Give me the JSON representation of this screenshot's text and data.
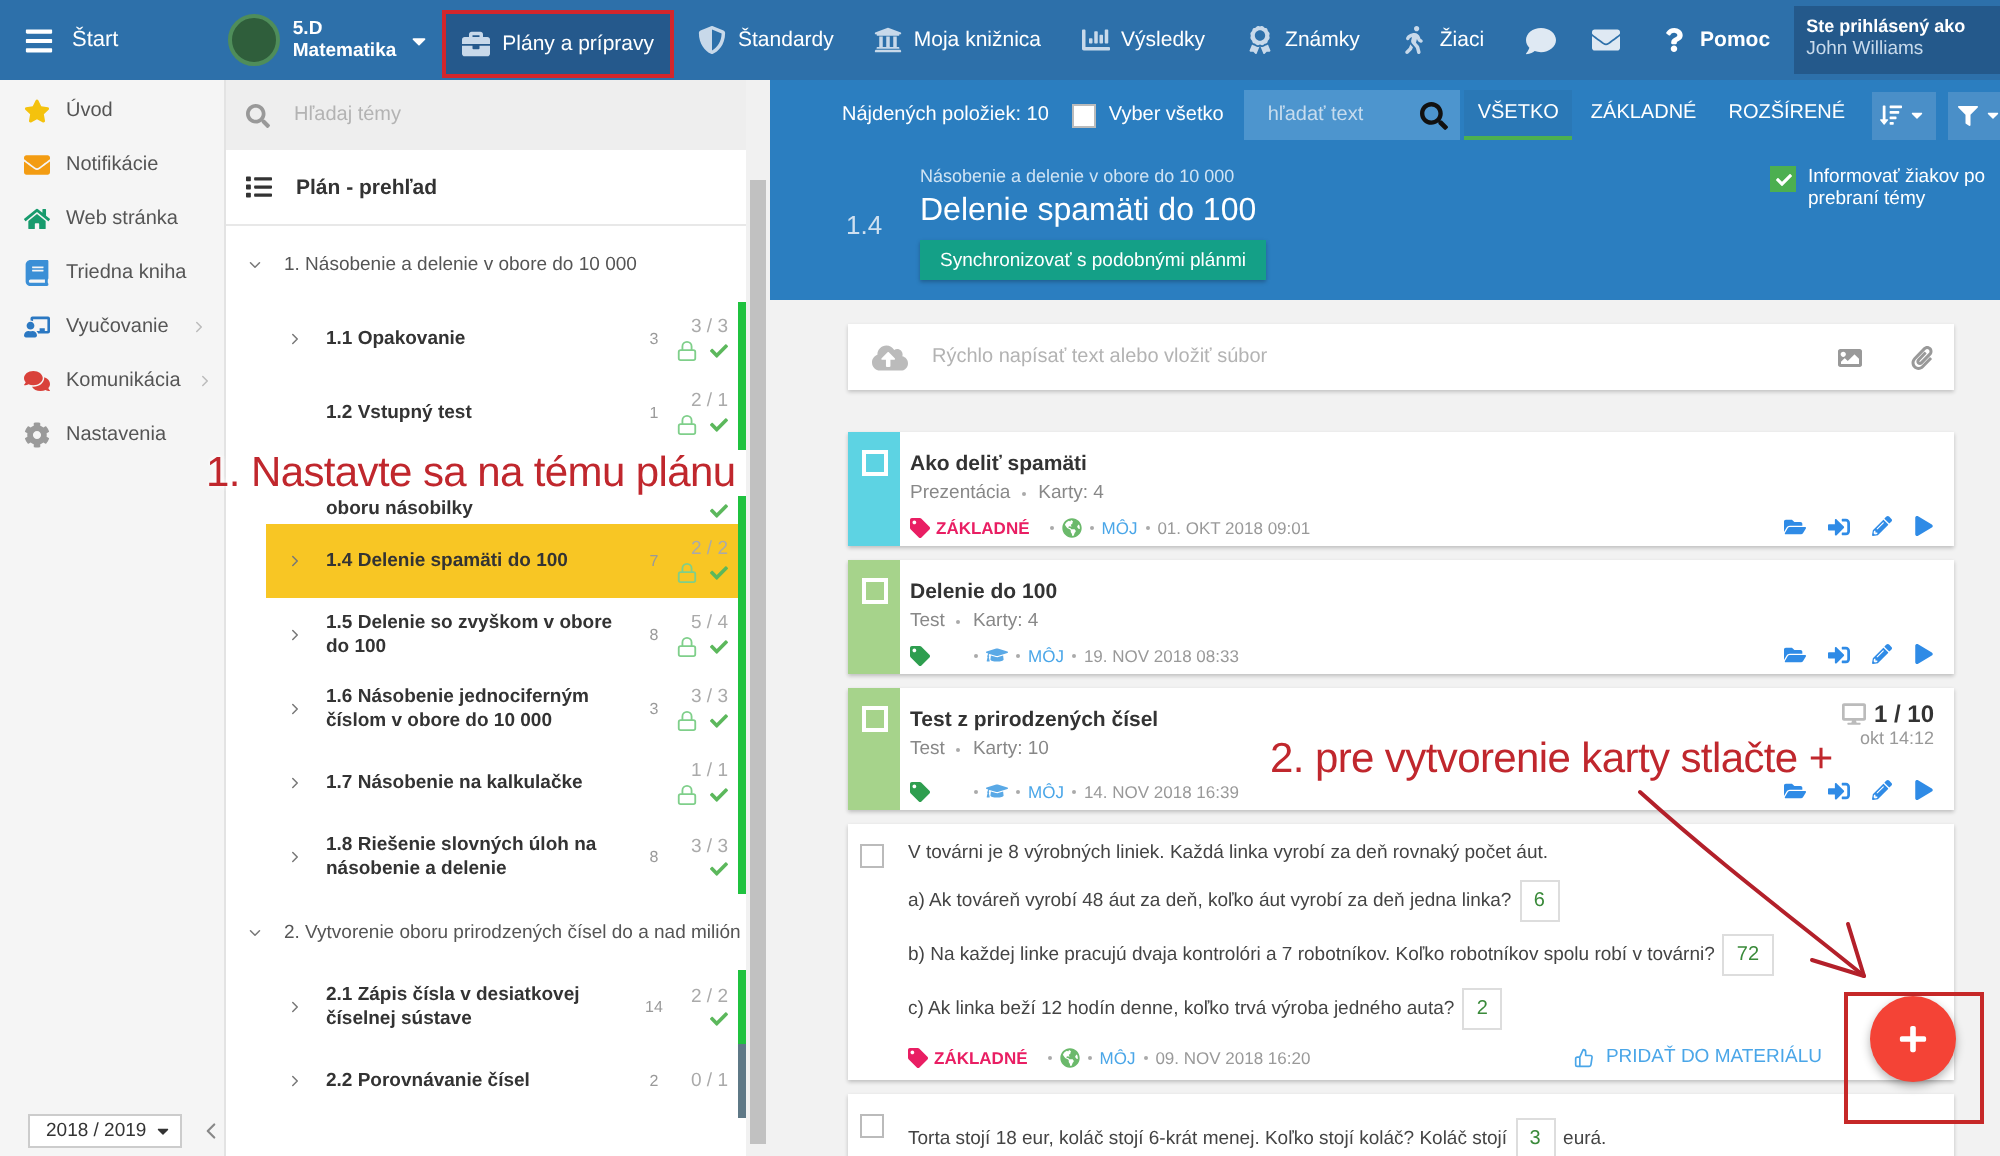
{
  "top_bar": {
    "menu_label": "Štart",
    "class": {
      "name": "5.D",
      "subject": "Matematika"
    },
    "nav": [
      {
        "label": "Plány a prípravy",
        "selected": true,
        "highlighted": true
      },
      {
        "label": "Štandardy",
        "selected": false,
        "highlighted": false
      },
      {
        "label": "Moja knižnica",
        "selected": false,
        "highlighted": false
      },
      {
        "label": "Výsledky",
        "selected": false,
        "highlighted": false
      },
      {
        "label": "Známky",
        "selected": false,
        "highlighted": false
      },
      {
        "label": "Žiaci",
        "selected": false,
        "highlighted": false
      }
    ],
    "help": "Pomoc",
    "user": {
      "caption": "Ste prihlásený ako",
      "name": "John Williams"
    }
  },
  "sidebar": {
    "items": [
      {
        "label": "Úvod",
        "submenu": false
      },
      {
        "label": "Notifikácie",
        "submenu": false
      },
      {
        "label": "Web stránka",
        "submenu": false
      },
      {
        "label": "Triedna kniha",
        "submenu": false
      },
      {
        "label": "Vyučovanie",
        "submenu": true
      },
      {
        "label": "Komunikácia",
        "submenu": true
      },
      {
        "label": "Nastavenia",
        "submenu": false
      }
    ],
    "year": "2018 / 2019"
  },
  "plan": {
    "search_placeholder": "Hľadaj témy",
    "overview": "Plán - prehľad",
    "groups": [
      {
        "title": "1. Násobenie a delenie v obore do 10 000",
        "expanded": true,
        "children": [
          {
            "title": "1.1 Opakovanie",
            "has_children": true,
            "count": "3",
            "progress": "3 / 3",
            "locked": true,
            "done": true,
            "selected": false,
            "color": "#1fc23f"
          },
          {
            "title": "1.2 Vstupný test",
            "has_children": false,
            "count": "1",
            "progress": "2 / 1",
            "locked": true,
            "done": true,
            "selected": false,
            "color": "#1fc23f"
          },
          {
            "title": "oboru násobilky",
            "has_children": false,
            "locked": false,
            "done": true,
            "selected": false,
            "color": "#1fc23f"
          },
          {
            "title": "1.4 Delenie spamäti do 100",
            "has_children": true,
            "count": "7",
            "progress": "2 / 2",
            "locked": true,
            "done": true,
            "selected": true,
            "color": "#1fc23f"
          },
          {
            "title": "1.5 Delenie so zvyškom v obore do 100",
            "has_children": true,
            "count": "8",
            "progress": "5 / 4",
            "locked": true,
            "done": true,
            "selected": false,
            "color": "#1fc23f"
          },
          {
            "title": "1.6 Násobenie jednociferným číslom v obore do 10 000",
            "has_children": true,
            "count": "3",
            "progress": "3 / 3",
            "locked": true,
            "done": true,
            "selected": false,
            "color": "#1fc23f"
          },
          {
            "title": "1.7 Násobenie na kalkulačke",
            "has_children": true,
            "progress": "1 / 1",
            "locked": true,
            "done": true,
            "selected": false,
            "color": "#1fc23f"
          },
          {
            "title": "1.8 Riešenie slovných úloh na násobenie a delenie",
            "has_children": true,
            "count": "8",
            "progress": "3 / 3",
            "locked": false,
            "done": true,
            "selected": false,
            "color": "#1fc23f"
          }
        ]
      },
      {
        "title": "2. Vytvorenie oboru prirodzených čísel do a nad milión",
        "expanded": true,
        "children": [
          {
            "title": "2.1 Zápis čísla v desiatkovej číselnej sústave",
            "has_children": true,
            "count": "14",
            "progress": "2 / 2",
            "locked": false,
            "done": true,
            "selected": false,
            "color": "#1fc23f"
          },
          {
            "title": "2.2 Porovnávanie čísel",
            "has_children": true,
            "count": "2",
            "progress": "0 / 1",
            "locked": false,
            "done": false,
            "selected": false,
            "color": "#5e7886"
          }
        ]
      }
    ]
  },
  "content": {
    "found": "Nájdených položiek: 10",
    "select_all": {
      "label": "Vyber všetko",
      "checked": false
    },
    "search_placeholder": "hľadať text",
    "filters": [
      {
        "label": "VŠETKO",
        "selected": true
      },
      {
        "label": "ZÁKLADNÉ",
        "selected": false
      },
      {
        "label": "ROZŠÍRENÉ",
        "selected": false
      }
    ],
    "topic": {
      "parent": "Násobenie a delenie v obore do 10 000",
      "number": "1.4",
      "title": "Delenie spamäti do 100",
      "sync_button": "Synchronizovať s podobnými plánmi",
      "notify": {
        "label": "Informovať žiakov po prebraní témy",
        "checked": true
      }
    },
    "quick_input_placeholder": "Rýchlo napísať text alebo vložiť súbor",
    "cards": [
      {
        "kind": "material",
        "checked": false,
        "color": "#5dd3e3",
        "title": "Ako deliť spamäti",
        "type": "Prezentácia",
        "cards": "Karty: 4",
        "tag": {
          "label": "ZÁKLADNÉ",
          "color": "#e91e63"
        },
        "public": true,
        "owner": "MÔJ",
        "date": "01. OKT 2018 09:01"
      },
      {
        "kind": "material",
        "checked": false,
        "color": "#a6d38b",
        "title": "Delenie do 100",
        "type": "Test",
        "cards": "Karty: 4",
        "tag": {
          "color": "#2e9e4f"
        },
        "public": false,
        "owner": "MÔJ",
        "date": "19. NOV 2018 08:33"
      },
      {
        "kind": "material",
        "checked": false,
        "color": "#a6d38b",
        "title": "Test z prirodzených čísel",
        "type": "Test",
        "cards": "Karty: 10",
        "tag": {
          "color": "#2e9e4f"
        },
        "public": false,
        "owner": "MÔJ",
        "date": "14. NOV 2018 16:39",
        "result": {
          "score": "1 / 10",
          "date": "okt 14:12"
        }
      },
      {
        "kind": "question",
        "checked": false,
        "intro": "V továrni je 8 výrobných liniek. Každá linka vyrobí za deň rovnaký počet áut.",
        "parts": [
          {
            "text": "a) Ak továreň vyrobí 48 áut za deň, koľko áut vyrobí za deň jedna linka?",
            "answer": "6"
          },
          {
            "text": "b) Na každej linke pracujú dvaja kontrolóri a 7 robotníkov. Koľko robotníkov spolu robí v továrni?",
            "answer": "72"
          },
          {
            "text": "c) Ak linka beží 12 hodín denne, koľko trvá výroba jedného auta?",
            "answer": "2"
          }
        ],
        "tag": {
          "label": "ZÁKLADNÉ",
          "color": "#e91e63"
        },
        "public": true,
        "owner": "MÔJ",
        "date": "09. NOV 2018 16:20",
        "action": "PRIDAŤ DO MATERIÁLU"
      },
      {
        "kind": "inline_question",
        "checked": false,
        "before": "Torta stojí 18 eur, koláč stojí 6-krát menej. Koľko stojí koláč? Koláč stojí",
        "answer": "3",
        "after": "eurá."
      }
    ],
    "fab": {
      "highlighted": true
    }
  },
  "annotations": [
    {
      "kind": "note",
      "text": "1. Nastavte sa na tému plánu"
    },
    {
      "kind": "note",
      "text": "2. pre vytvorenie karty stlačte +"
    },
    {
      "kind": "arrow"
    }
  ]
}
